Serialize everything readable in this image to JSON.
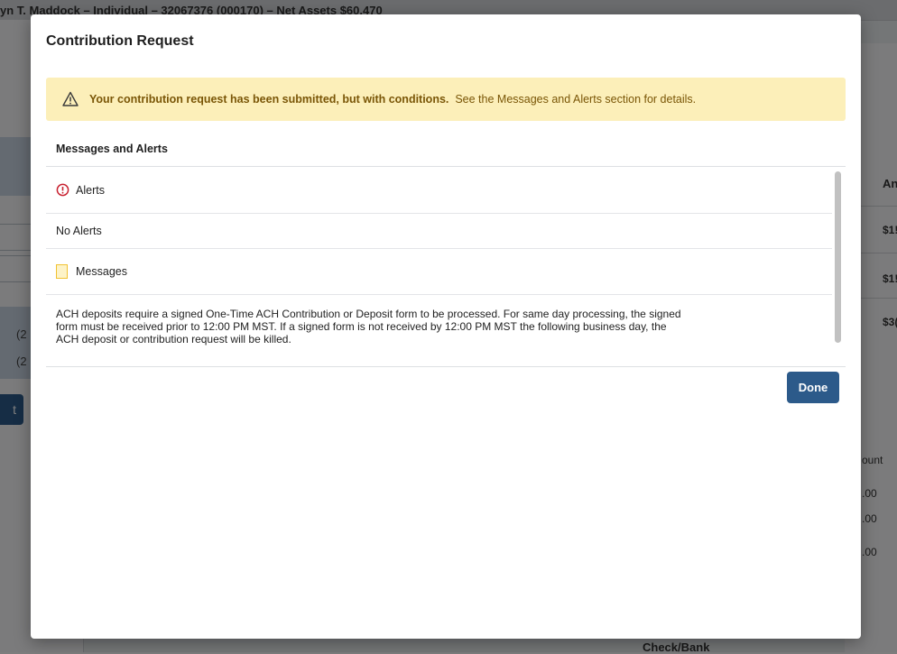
{
  "background": {
    "page_title": "yn T. Maddock – Individual – 32067376 (000170) – Net Assets $60,470",
    "left_items": [
      "(2",
      "(2"
    ],
    "left_button_label": "t",
    "right_header": "An",
    "right_cells": [
      "$1!",
      "$1!",
      "$3("
    ],
    "right2_header": "ount",
    "right2_cells": [
      ".00",
      ".00",
      ".00"
    ],
    "bottom_label": "Check/Bank"
  },
  "modal": {
    "title": "Contribution Request",
    "banner": {
      "icon": "warning-triangle-icon",
      "bold_text": "Your contribution request has been submitted, but with conditions.",
      "text": "See the Messages and Alerts section for details."
    },
    "section_title": "Messages and Alerts",
    "alerts_label": "Alerts",
    "alerts_icon": "exclamation-circle-icon",
    "no_alerts": "No Alerts",
    "messages_label": "Messages",
    "messages_icon": "message-square-icon",
    "message_text": "ACH deposits require a signed One-Time ACH Contribution or Deposit form to be processed. For same day processing, the signed form must be received prior to 12:00 PM MST. If a signed form is not received by 12:00 PM MST the following business day, the ACH deposit or contribution request will be killed.",
    "done_label": "Done"
  },
  "colors": {
    "banner_bg": "#fcefb9",
    "banner_text": "#7a5607",
    "alert_red": "#c8202f",
    "primary_button": "#2c5a8a"
  }
}
